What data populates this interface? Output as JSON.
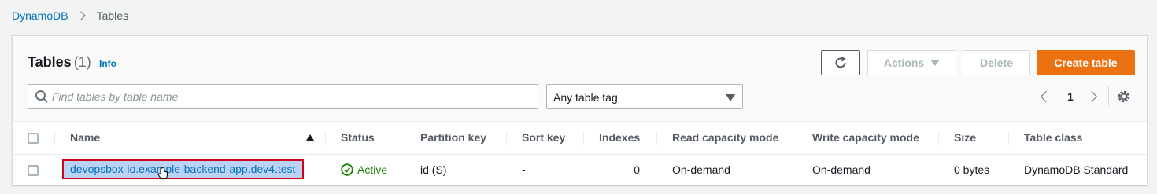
{
  "breadcrumb": {
    "root": "DynamoDB",
    "current": "Tables"
  },
  "panel": {
    "title": "Tables",
    "count": "(1)",
    "info": "Info",
    "buttons": {
      "actions": "Actions",
      "delete": "Delete",
      "create": "Create table"
    },
    "search": {
      "placeholder": "Find tables by table name",
      "value": ""
    },
    "tag_filter": {
      "selected": "Any table tag"
    },
    "pagination": {
      "current_page": "1"
    }
  },
  "table": {
    "headers": {
      "name": "Name",
      "status": "Status",
      "partition_key": "Partition key",
      "sort_key": "Sort key",
      "indexes": "Indexes",
      "read_mode": "Read capacity mode",
      "write_mode": "Write capacity mode",
      "size": "Size",
      "table_class": "Table class"
    },
    "rows": [
      {
        "name": "devopsbox-io.example-backend-app.dev4.test",
        "status": "Active",
        "partition_key": "id (S)",
        "sort_key": "-",
        "indexes": "0",
        "read_mode": "On-demand",
        "write_mode": "On-demand",
        "size": "0 bytes",
        "table_class": "DynamoDB Standard"
      }
    ]
  },
  "colors": {
    "accent": "#ec7211",
    "link": "#0073bb",
    "active": "#1d8102",
    "highlight_border": "#d0021b"
  }
}
